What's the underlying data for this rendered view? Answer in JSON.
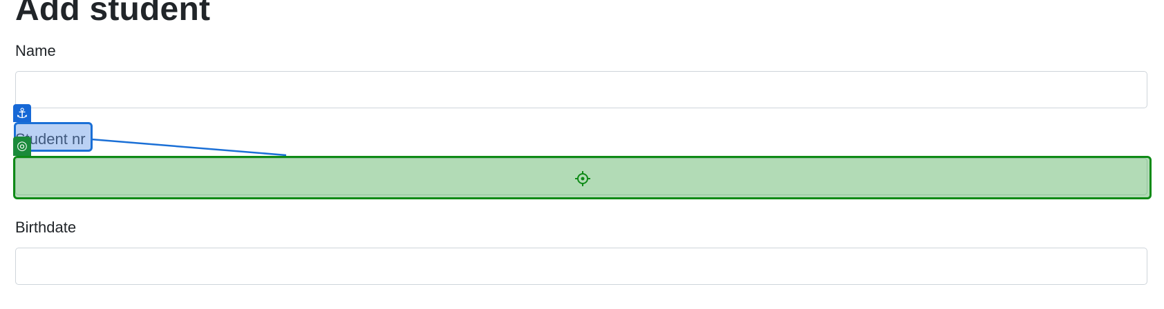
{
  "page": {
    "title": "Add student"
  },
  "form": {
    "fields": [
      {
        "label": "Name",
        "value": "",
        "placeholder": ""
      },
      {
        "label": "Student nr",
        "value": "",
        "placeholder": ""
      },
      {
        "label": "Birthdate",
        "value": "",
        "placeholder": ""
      }
    ]
  },
  "overlay": {
    "anchor_color": "#1a6fd6",
    "target_color": "#0e8a16",
    "anchor_icon": "anchor-icon",
    "target_icon": "target-icon",
    "crosshair_icon": "crosshair-icon"
  }
}
